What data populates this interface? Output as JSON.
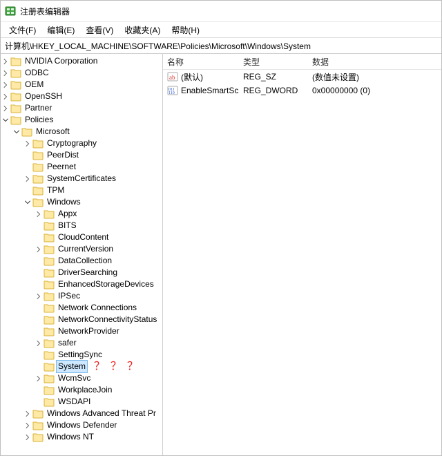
{
  "window": {
    "title": "注册表编辑器"
  },
  "menu": {
    "file": "文件(F)",
    "edit": "编辑(E)",
    "view": "查看(V)",
    "favorites": "收藏夹(A)",
    "help": "帮助(H)"
  },
  "address": {
    "path": "计算机\\HKEY_LOCAL_MACHINE\\SOFTWARE\\Policies\\Microsoft\\Windows\\System"
  },
  "tree": {
    "annotation": "？？？",
    "nodes": [
      {
        "depth": 0,
        "expander": "closed",
        "label": "NVIDIA Corporation",
        "selected": false
      },
      {
        "depth": 0,
        "expander": "closed",
        "label": "ODBC",
        "selected": false
      },
      {
        "depth": 0,
        "expander": "closed",
        "label": "OEM",
        "selected": false
      },
      {
        "depth": 0,
        "expander": "closed",
        "label": "OpenSSH",
        "selected": false
      },
      {
        "depth": 0,
        "expander": "closed",
        "label": "Partner",
        "selected": false
      },
      {
        "depth": 0,
        "expander": "open",
        "label": "Policies",
        "selected": false
      },
      {
        "depth": 1,
        "expander": "open",
        "label": "Microsoft",
        "selected": false
      },
      {
        "depth": 2,
        "expander": "closed",
        "label": "Cryptography",
        "selected": false
      },
      {
        "depth": 2,
        "expander": "none",
        "label": "PeerDist",
        "selected": false
      },
      {
        "depth": 2,
        "expander": "none",
        "label": "Peernet",
        "selected": false
      },
      {
        "depth": 2,
        "expander": "closed",
        "label": "SystemCertificates",
        "selected": false
      },
      {
        "depth": 2,
        "expander": "none",
        "label": "TPM",
        "selected": false
      },
      {
        "depth": 2,
        "expander": "open",
        "label": "Windows",
        "selected": false
      },
      {
        "depth": 3,
        "expander": "closed",
        "label": "Appx",
        "selected": false
      },
      {
        "depth": 3,
        "expander": "none",
        "label": "BITS",
        "selected": false
      },
      {
        "depth": 3,
        "expander": "none",
        "label": "CloudContent",
        "selected": false
      },
      {
        "depth": 3,
        "expander": "closed",
        "label": "CurrentVersion",
        "selected": false
      },
      {
        "depth": 3,
        "expander": "none",
        "label": "DataCollection",
        "selected": false
      },
      {
        "depth": 3,
        "expander": "none",
        "label": "DriverSearching",
        "selected": false
      },
      {
        "depth": 3,
        "expander": "none",
        "label": "EnhancedStorageDevices",
        "selected": false
      },
      {
        "depth": 3,
        "expander": "closed",
        "label": "IPSec",
        "selected": false
      },
      {
        "depth": 3,
        "expander": "none",
        "label": "Network Connections",
        "selected": false
      },
      {
        "depth": 3,
        "expander": "none",
        "label": "NetworkConnectivityStatus",
        "selected": false
      },
      {
        "depth": 3,
        "expander": "none",
        "label": "NetworkProvider",
        "selected": false
      },
      {
        "depth": 3,
        "expander": "closed",
        "label": "safer",
        "selected": false
      },
      {
        "depth": 3,
        "expander": "none",
        "label": "SettingSync",
        "selected": false
      },
      {
        "depth": 3,
        "expander": "none",
        "label": "System",
        "selected": true,
        "annotate": true
      },
      {
        "depth": 3,
        "expander": "closed",
        "label": "WcmSvc",
        "selected": false
      },
      {
        "depth": 3,
        "expander": "none",
        "label": "WorkplaceJoin",
        "selected": false
      },
      {
        "depth": 3,
        "expander": "none",
        "label": "WSDAPI",
        "selected": false
      },
      {
        "depth": 2,
        "expander": "closed",
        "label": "Windows Advanced Threat Pr",
        "selected": false
      },
      {
        "depth": 2,
        "expander": "closed",
        "label": "Windows Defender",
        "selected": false
      },
      {
        "depth": 2,
        "expander": "closed",
        "label": "Windows NT",
        "selected": false
      }
    ]
  },
  "list": {
    "columns": {
      "name": "名称",
      "type": "类型",
      "data": "数据"
    },
    "rows": [
      {
        "icon": "string",
        "name": "(默认)",
        "type": "REG_SZ",
        "data": "(数值未设置)"
      },
      {
        "icon": "dword",
        "name": "EnableSmartSc...",
        "type": "REG_DWORD",
        "data": "0x00000000 (0)"
      }
    ]
  }
}
